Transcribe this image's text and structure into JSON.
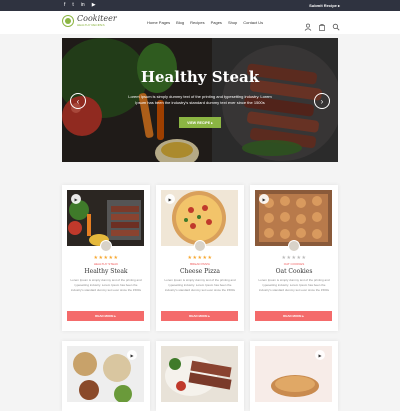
{
  "topbar": {
    "social": [
      "f",
      "t",
      "in",
      "▶"
    ],
    "submit": "Submit Recipe ▸"
  },
  "logo": {
    "name": "Cookiteer",
    "tagline": "HEALTHY RECIPES"
  },
  "nav": [
    "Home Pages",
    "Blog",
    "Recipes",
    "Pages",
    "Shop",
    "Contact Us"
  ],
  "hero": {
    "title": "Healthy Steak",
    "desc": "Lorem Ipsum is simply dummy text of the printing and typesetting industry. Lorem Ipsum has been the industry's standard dummy text ever since the 1500s",
    "button": "VIEW RECIPE ▸",
    "prev": "‹",
    "next": "›"
  },
  "cards": [
    {
      "stars": "★★★★★",
      "category": "HEALTHY STEAK",
      "title": "Healthy Steak",
      "desc": "Lorem Ipsum is simply dummy text of the printing and typesetting industry. Lorem Ipsum has been the industry's standard dummy text ever since the 1500s",
      "button": "READ MORE ▸"
    },
    {
      "stars": "★★★★★",
      "category": "BREAD PIZZA",
      "title": "Cheese Pizza",
      "desc": "Lorem Ipsum is simply dummy text of the printing and typesetting industry. Lorem Ipsum has been the industry's standard dummy text ever since the 1500s",
      "button": "READ MORE ▸"
    },
    {
      "stars": "★★★★★",
      "category": "OAT COOKIES",
      "title": "Oat Cookies",
      "desc": "Lorem Ipsum is simply dummy text of the printing and typesetting industry. Lorem Ipsum has been the industry's standard dummy text ever since the 1500s",
      "button": "READ MORE ▸"
    }
  ],
  "colors": {
    "accent": "#8bb543",
    "button": "#f46b6b",
    "star": "#f7a831",
    "topbar": "#2f3340"
  }
}
